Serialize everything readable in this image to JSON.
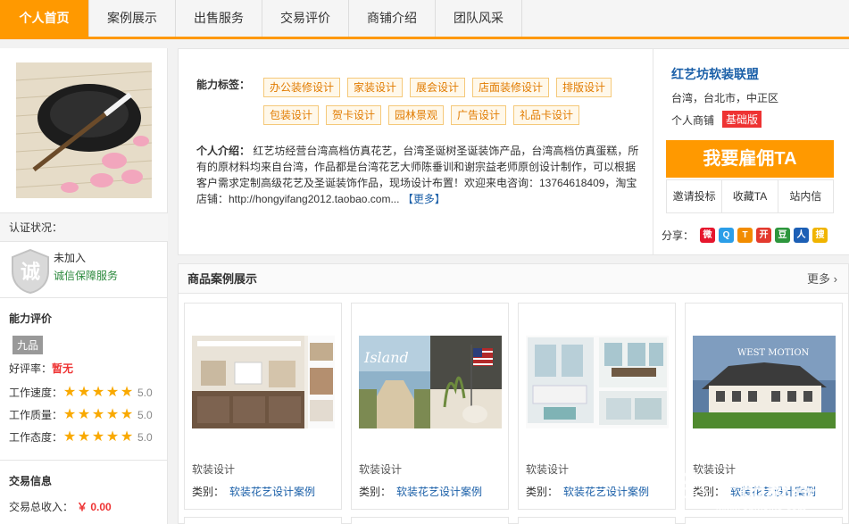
{
  "nav": {
    "tabs": [
      {
        "label": "个人首页",
        "active": true
      },
      {
        "label": "案例展示"
      },
      {
        "label": "出售服务"
      },
      {
        "label": "交易评价"
      },
      {
        "label": "商铺介绍"
      },
      {
        "label": "团队风采"
      }
    ]
  },
  "sidebar": {
    "verify_label": "认证状况：",
    "trust_status": "未加入",
    "trust_link": "诚信保障服务",
    "shield_char": "诚",
    "ability_title": "能力评价",
    "level": "九品",
    "rate_label": "好评率：",
    "rate_value": "暂无",
    "scores": [
      {
        "label": "工作速度：",
        "value": "5.0",
        "stars": 5
      },
      {
        "label": "工作质量：",
        "value": "5.0",
        "stars": 5
      },
      {
        "label": "工作态度：",
        "value": "5.0",
        "stars": 5
      }
    ],
    "trade_title": "交易信息",
    "trade_income_label": "交易总收入：",
    "trade_income_value": "￥ 0.00"
  },
  "profile": {
    "tags_label": "能力标签：",
    "tags": [
      "办公装修设计",
      "家装设计",
      "展会设计",
      "店面装修设计",
      "排版设计",
      "包装设计",
      "贺卡设计",
      "园林景观",
      "广告设计",
      "礼品卡设计"
    ],
    "intro_label": "个人介绍：",
    "intro_text": "红艺坊经营台湾高档仿真花艺，台湾圣诞树圣诞装饰产品，台湾高档仿真蛋糕，所有的原材料均来自台湾，作品都是台湾花艺大师陈垂训和谢宗益老师原创设计制作，可以根据客户需求定制高级花艺及圣诞装饰作品，现场设计布置！欢迎来电咨询：13764618409，淘宝店铺：http://hongyifang2012.taobao.com...",
    "intro_more": "【更多】"
  },
  "shop": {
    "name": "红艺坊软装联盟",
    "location": "台湾，台北市，中正区",
    "type": "个人商铺",
    "badge": "基础版",
    "hire_label": "我要雇佣TA",
    "actions": [
      "邀请投标",
      "收藏TA",
      "站内信"
    ],
    "share_label": "分享："
  },
  "share_icons": [
    {
      "name": "weibo-icon",
      "color": "#e6162d",
      "glyph": "微"
    },
    {
      "name": "qzone-icon",
      "color": "#2b9ee8",
      "glyph": "Q"
    },
    {
      "name": "tencent-weibo-icon",
      "color": "#f28c00",
      "glyph": "T"
    },
    {
      "name": "kaixin-icon",
      "color": "#e33a2e",
      "glyph": "开"
    },
    {
      "name": "douban-icon",
      "color": "#2d963d",
      "glyph": "豆"
    },
    {
      "name": "renren-icon",
      "color": "#1c5fb5",
      "glyph": "人"
    },
    {
      "name": "sohu-icon",
      "color": "#f0b400",
      "glyph": "搜"
    }
  ],
  "products": {
    "title": "商品案例展示",
    "more": "更多 ›",
    "items": [
      {
        "title": "软装设计",
        "cat_label": "类别：",
        "cat": "软装花艺设计案例"
      },
      {
        "title": "软装设计",
        "cat_label": "类别：",
        "cat": "软装花艺设计案例"
      },
      {
        "title": "软装设计",
        "cat_label": "类别：",
        "cat": "软装花艺设计案例"
      },
      {
        "title": "软装设计",
        "cat_label": "类别：",
        "cat": "软装花艺设计案例"
      }
    ]
  },
  "watermark": {
    "brand": "一品威客",
    "url": "www.epweike.com"
  },
  "colors": {
    "accent": "#ff9900",
    "link": "#1a5fa8",
    "price": "#e33333",
    "tag_text": "#e17b00"
  }
}
